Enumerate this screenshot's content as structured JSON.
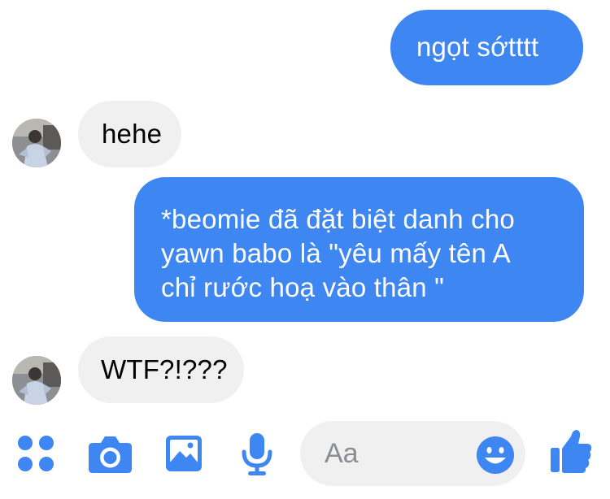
{
  "colors": {
    "accent": "#3e86f2",
    "incoming_bubble": "#f0f0f0",
    "composer_bg": "#f0f0f0",
    "placeholder": "#8a8d91"
  },
  "messages": [
    {
      "direction": "outgoing",
      "text": "ngọt sớtttt"
    },
    {
      "direction": "incoming",
      "text": "hehe",
      "avatar": "avatar"
    },
    {
      "direction": "outgoing",
      "lines": [
        "*beomie đã đặt biệt danh cho",
        "yawn babo là \"yêu mấy tên A",
        "chỉ rước hoạ vào thân \""
      ]
    },
    {
      "direction": "incoming",
      "text": "WTF?!???",
      "avatar": "avatar"
    }
  ],
  "composer": {
    "placeholder": "Aa",
    "icons": [
      "apps-icon",
      "camera-icon",
      "gallery-icon",
      "microphone-icon",
      "emoji-icon",
      "thumbs-up-icon"
    ]
  }
}
